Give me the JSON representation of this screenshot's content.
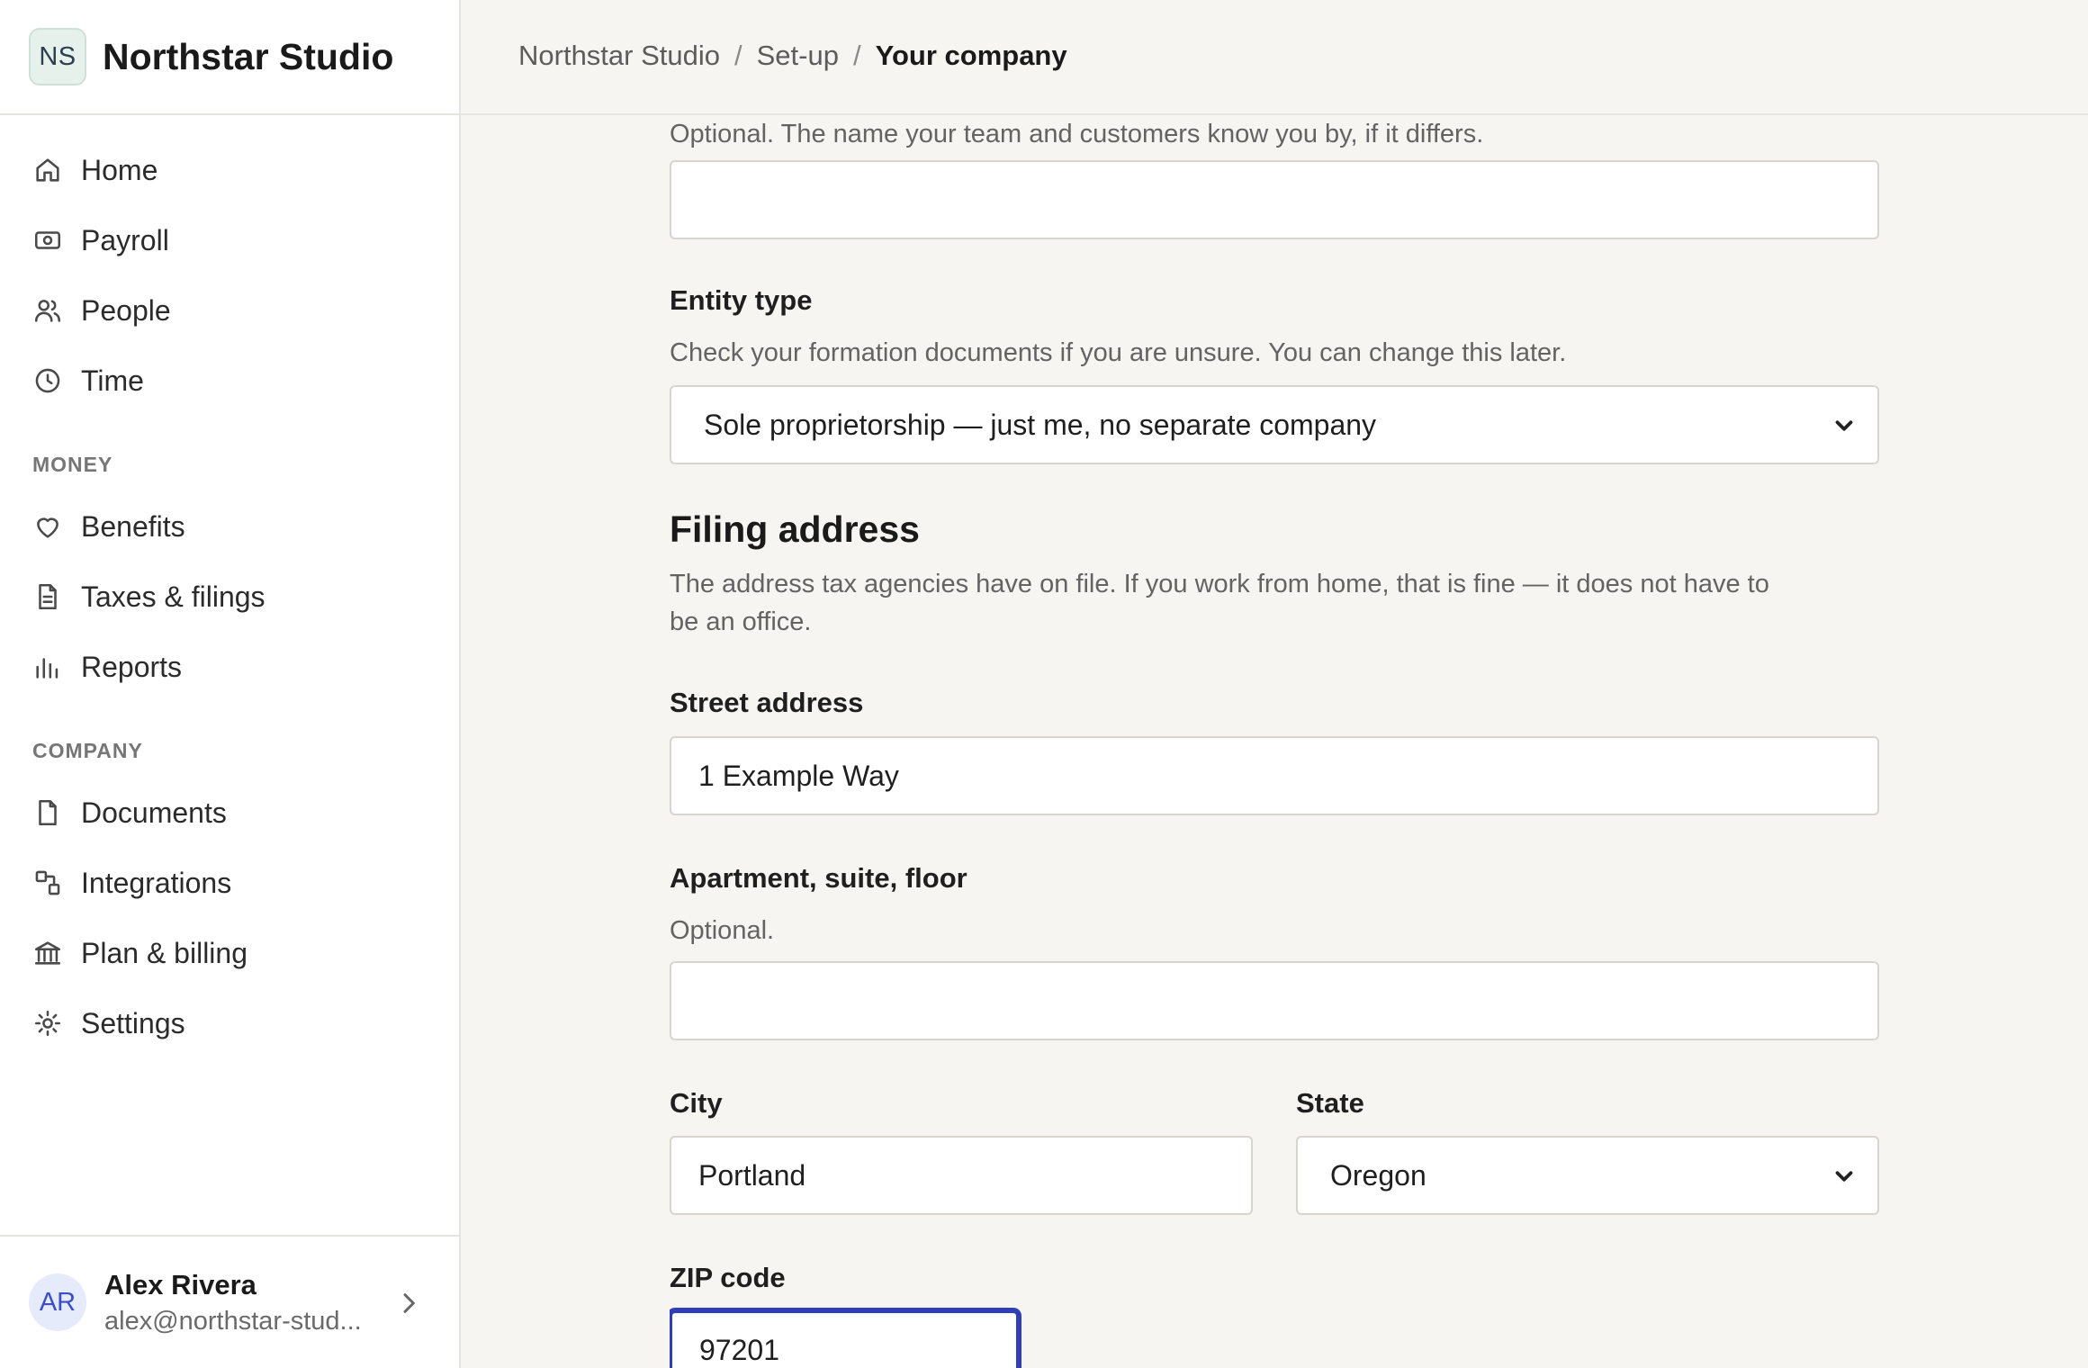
{
  "brand": {
    "initials": "NS",
    "name": "Northstar Studio"
  },
  "nav": {
    "main": [
      {
        "label": "Home",
        "icon": "home-icon"
      },
      {
        "label": "Payroll",
        "icon": "payroll-icon"
      },
      {
        "label": "People",
        "icon": "people-icon"
      },
      {
        "label": "Time",
        "icon": "clock-icon"
      }
    ],
    "money_heading": "MONEY",
    "money": [
      {
        "label": "Benefits",
        "icon": "heart-icon"
      },
      {
        "label": "Taxes & filings",
        "icon": "document-icon"
      },
      {
        "label": "Reports",
        "icon": "bar-chart-icon"
      }
    ],
    "company_heading": "COMPANY",
    "company": [
      {
        "label": "Documents",
        "icon": "file-icon"
      },
      {
        "label": "Integrations",
        "icon": "integrations-icon"
      },
      {
        "label": "Plan & billing",
        "icon": "bank-icon"
      },
      {
        "label": "Settings",
        "icon": "gear-icon"
      }
    ]
  },
  "user": {
    "initials": "AR",
    "name": "Alex Rivera",
    "email": "alex@northstar-stud..."
  },
  "breadcrumb": [
    "Northstar Studio",
    "Set-up",
    "Your company"
  ],
  "form": {
    "dba_help": "Optional. The name your team and customers know you by, if it differs.",
    "dba_value": "",
    "entity_label": "Entity type",
    "entity_help": "Check your formation documents if you are unsure. You can change this later.",
    "entity_value": "Sole proprietorship — just me, no separate company",
    "address_heading": "Filing address",
    "address_help_1": "The address tax agencies have on file. If you work from home, that is fine — it does not have to",
    "address_help_2": "be an office.",
    "street_label": "Street address",
    "street_value": "1 Example Way",
    "apt_label": "Apartment, suite, floor",
    "apt_help": "Optional.",
    "apt_value": "",
    "city_label": "City",
    "city_value": "Portland",
    "state_label": "State",
    "state_value": "Oregon",
    "zip_label": "ZIP code",
    "zip_value": "97201"
  }
}
